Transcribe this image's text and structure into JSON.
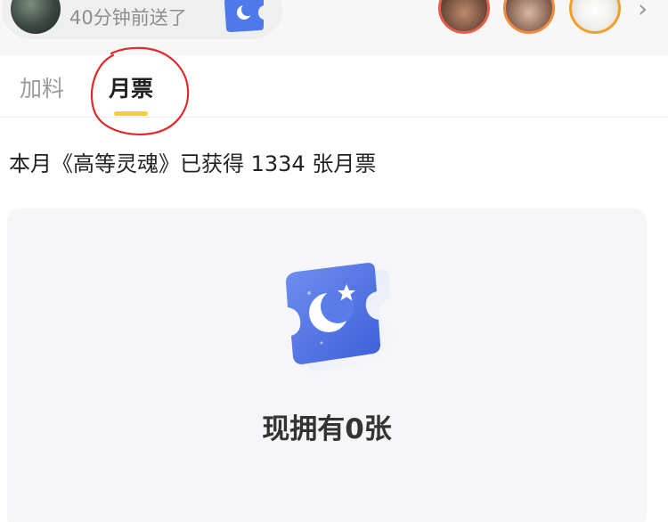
{
  "sender": {
    "time_text": "40分钟前送了",
    "ticket_icon": "moon-ticket-icon"
  },
  "recent_senders": [
    {
      "avatar": "avatar"
    },
    {
      "avatar": "avatar"
    },
    {
      "avatar": "avatar"
    }
  ],
  "tabs": [
    {
      "label": "加料",
      "active": false
    },
    {
      "label": "月票",
      "active": true
    }
  ],
  "colors": {
    "tab_underline": "#f5d12a",
    "annotation": "#e02a2a",
    "ticket_blue": "#4f79ea"
  },
  "summary": "本月《高等灵魂》已获得 1334 张月票",
  "card": {
    "ticket_icon": "moon-ticket-icon",
    "count_text": "现拥有0张"
  }
}
